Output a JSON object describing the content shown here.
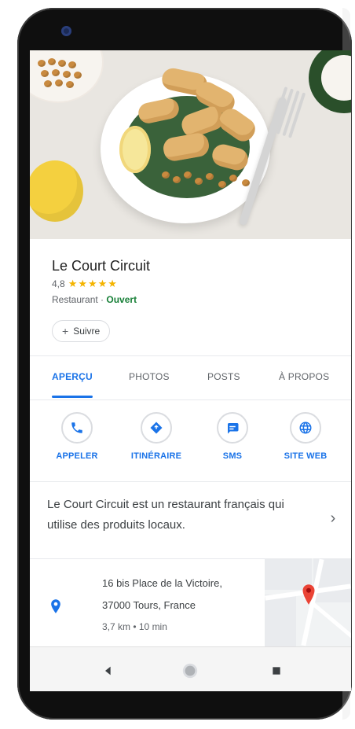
{
  "place": {
    "name": "Le Court Circuit",
    "rating": "4,8",
    "stars": "★★★★★",
    "category": "Restaurant",
    "separator": "·",
    "status": "Ouvert",
    "follow_label": "Suivre"
  },
  "tabs": [
    {
      "label": "APERÇU",
      "active": true
    },
    {
      "label": "PHOTOS",
      "active": false
    },
    {
      "label": "POSTS",
      "active": false
    },
    {
      "label": "À PROPOS",
      "active": false
    }
  ],
  "actions": [
    {
      "label": "APPELER",
      "icon": "phone-icon"
    },
    {
      "label": "ITINÉRAIRE",
      "icon": "directions-icon"
    },
    {
      "label": "SMS",
      "icon": "message-icon"
    },
    {
      "label": "SITE WEB",
      "icon": "globe-icon"
    }
  ],
  "description": "Le Court Circuit est un restaurant français qui utilise des produits locaux.",
  "address": {
    "line1": "16 bis Place de la Victoire,",
    "line2": "37000 Tours, France",
    "distance": "3,7 km • 10 min"
  },
  "colors": {
    "accent": "#1a73e8",
    "open": "#188038",
    "stars": "#f4b400",
    "map_pin": "#ea4335"
  },
  "nav": [
    "back-icon",
    "home-icon",
    "recents-icon"
  ]
}
